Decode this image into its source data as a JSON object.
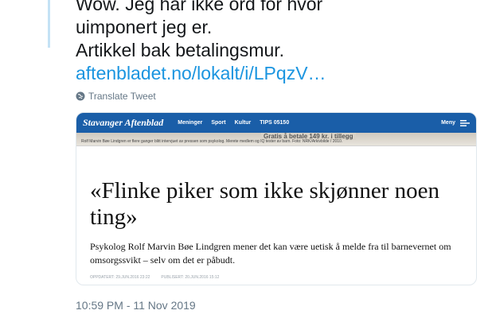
{
  "tweet": {
    "text_lines": [
      "Wow. Jeg har ikke ord for hvor",
      "uimponert jeg er.",
      "Artikkel bak betalingsmur."
    ],
    "link": "aftenbladet.no/lokalt/i/LPqzV…",
    "translate_label": "Translate Tweet",
    "timestamp": "10:59 PM - 11 Nov 2019"
  },
  "card": {
    "site_name": "Stavanger Aftenblad",
    "nav": [
      "Meninger",
      "Sport",
      "Kultur",
      "TIPS 05150"
    ],
    "menu_label": "Meny",
    "photo_sign": "Gratis å betale 149 kr. i tillegg",
    "photo_caption": "Rolf Marvin Bøe Lindgren er flere ganger blitt intervjuet av pressen som psykolog. Merete medlem og IQ tester av barn. Foto: NRK/Arkivbilde / 2010.",
    "headline": "«Flinke piker som ikke skjønner noen ting»",
    "lede": "Psykolog Rolf Marvin Bøe Lindgren mener det kan være uetisk å melde fra til barnevernet om omsorgssvikt – selv om det er påbudt.",
    "updated": "OPPDATERT: 29.JUN.2016 23:22",
    "published": "PUBLISERT: 20.JUN.2016 15:12"
  },
  "colors": {
    "link": "#1b95e0",
    "header_bg": "#1a5ea8",
    "meta_text": "#657786",
    "thread_line": "#c4e2f5"
  },
  "icons": {
    "translate": "globe-icon",
    "menu": "hamburger-menu-icon"
  }
}
